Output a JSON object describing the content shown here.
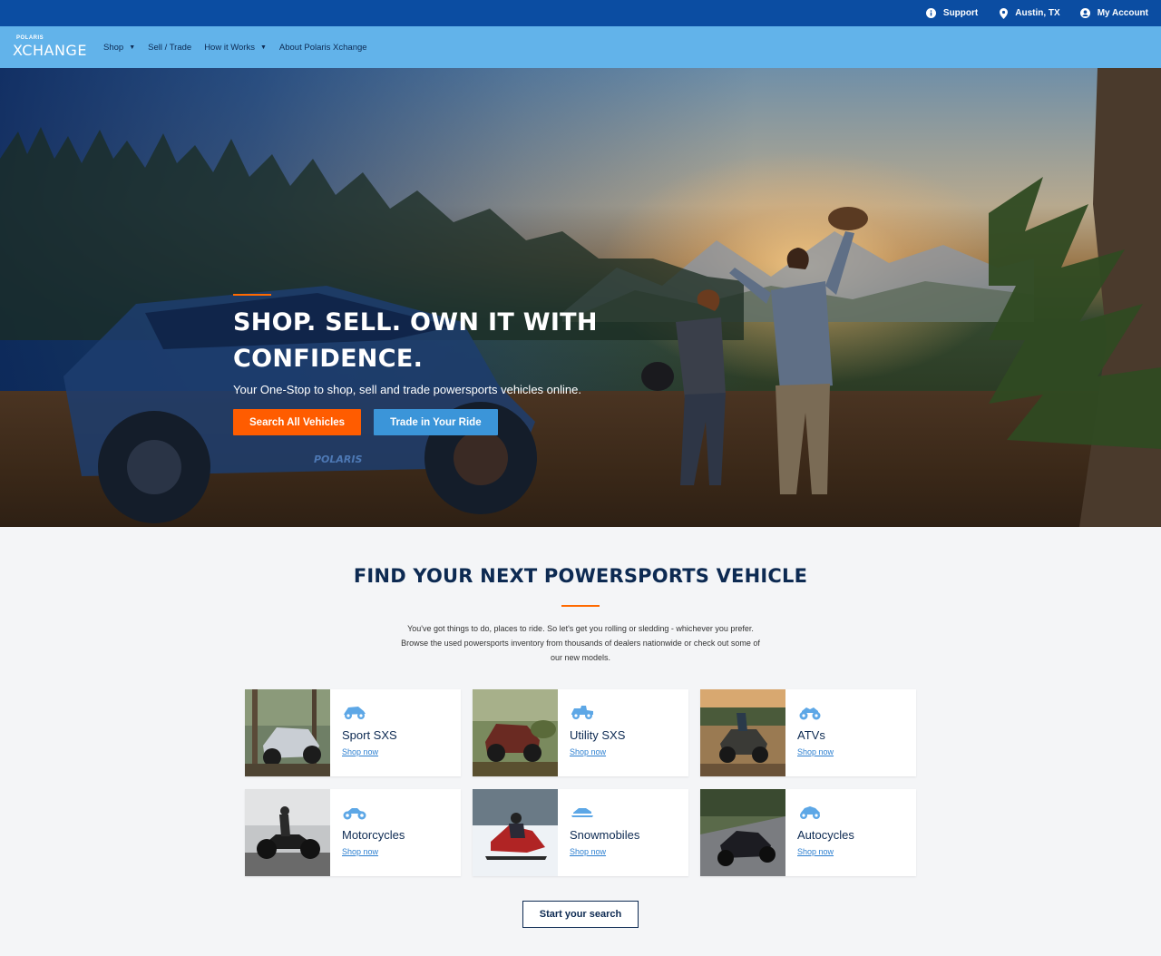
{
  "utility": {
    "support": "Support",
    "location": "Austin, TX",
    "account": "My Account"
  },
  "nav": {
    "logo_small": "POLARIS",
    "logo_main": "XCHANGE",
    "links": [
      {
        "label": "Shop",
        "has_caret": true
      },
      {
        "label": "Sell / Trade",
        "has_caret": false
      },
      {
        "label": "How it Works",
        "has_caret": true
      },
      {
        "label": "About Polaris Xchange",
        "has_caret": false
      }
    ]
  },
  "hero": {
    "title_line1": "SHOP. SELL. OWN IT WITH",
    "title_line2": "CONFIDENCE.",
    "subtitle": "Your One-Stop to shop, sell and trade powersports vehicles online.",
    "btn_search": "Search All Vehicles",
    "btn_trade": "Trade in Your Ride",
    "vehicle_brand": "POLARIS"
  },
  "find": {
    "title": "FIND YOUR NEXT POWERSPORTS VEHICLE",
    "description": "You've got things to do, places to ride. So let's get you rolling or sledding - whichever you prefer. Browse the used powersports inventory from thousands of dealers nationwide or check out some of our new models.",
    "categories": [
      {
        "title": "Sport SXS",
        "link": "Shop now",
        "icon": "sxs-icon"
      },
      {
        "title": "Utility SXS",
        "link": "Shop now",
        "icon": "utility-sxs-icon"
      },
      {
        "title": "ATVs",
        "link": "Shop now",
        "icon": "atv-icon"
      },
      {
        "title": "Motorcycles",
        "link": "Shop now",
        "icon": "motorcycle-icon"
      },
      {
        "title": "Snowmobiles",
        "link": "Shop now",
        "icon": "snowmobile-icon"
      },
      {
        "title": "Autocycles",
        "link": "Shop now",
        "icon": "autocycle-icon"
      }
    ],
    "start_button": "Start your search"
  },
  "colors": {
    "utility_bar": "#0b4da2",
    "nav_bar": "#62b3ea",
    "accent_orange": "#ff5c00",
    "accent_blue": "#3b95d9",
    "navy_text": "#0d2a52"
  }
}
